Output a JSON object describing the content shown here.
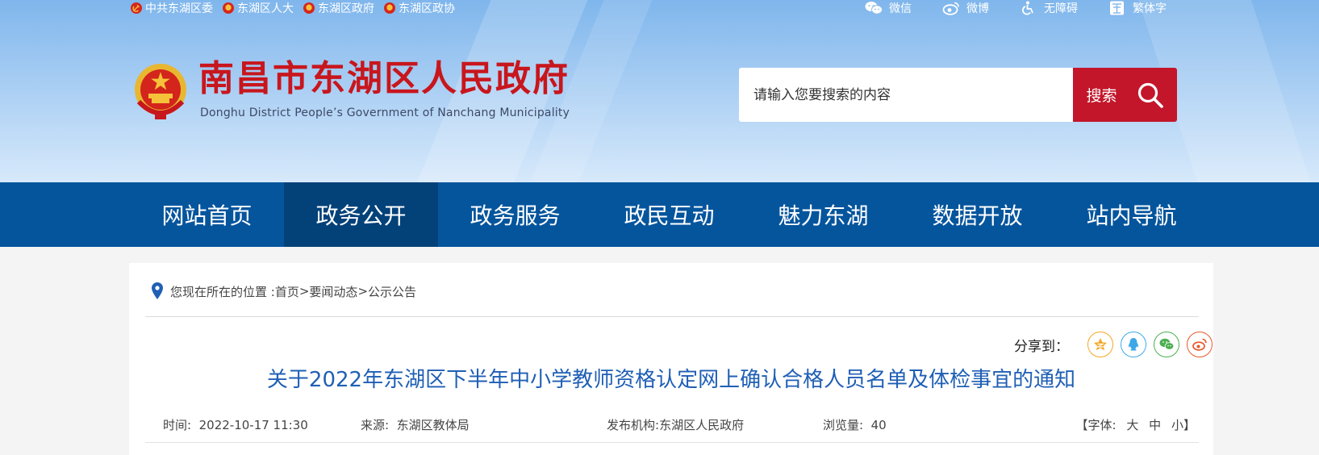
{
  "header": {
    "top_links": [
      {
        "label": "中共东湖区委",
        "icon": "party-emblem-icon"
      },
      {
        "label": "东湖区人大",
        "icon": "national-emblem-icon"
      },
      {
        "label": "东湖区政府",
        "icon": "national-emblem-icon"
      },
      {
        "label": "东湖区政协",
        "icon": "cppcc-emblem-icon"
      }
    ],
    "right_links": [
      {
        "label": "微信",
        "icon": "wechat-icon"
      },
      {
        "label": "微博",
        "icon": "weibo-icon"
      },
      {
        "label": "无障碍",
        "icon": "accessibility-icon"
      },
      {
        "label": "繁体字",
        "icon": "traditional-chinese-icon"
      }
    ],
    "site_title": "南昌市东湖区人民政府",
    "site_subtitle": "Donghu District  People’s Government of Nanchang  Municipality",
    "search": {
      "placeholder": "请输入您要搜索的内容",
      "button_label": "搜索"
    }
  },
  "nav": {
    "items": [
      "网站首页",
      "政务公开",
      "政务服务",
      "政民互动",
      "魅力东湖",
      "数据开放",
      "站内导航"
    ],
    "active_index": 1
  },
  "breadcrumb": {
    "prefix": "您现在所在的位置 : ",
    "items": [
      "首页",
      "要闻动态",
      "公示公告"
    ],
    "separator": ">"
  },
  "share": {
    "label": "分享到：",
    "targets": [
      {
        "name": "qzone",
        "icon": "qzone-icon",
        "color": "#f5a623"
      },
      {
        "name": "qq",
        "icon": "qq-icon",
        "color": "#3ea7e8"
      },
      {
        "name": "wechat",
        "icon": "wechat-icon",
        "color": "#4caf50"
      },
      {
        "name": "weibo",
        "icon": "weibo-icon",
        "color": "#e8572a"
      }
    ]
  },
  "article": {
    "title": "关于2022年东湖区下半年中小学教师资格认定网上确认合格人员名单及体检事宜的通知",
    "meta": {
      "time_label": "时间:",
      "time": "2022-10-17 11:30",
      "source_label": "来源:",
      "source": "东湖区教体局",
      "publisher_label": "发布机构:",
      "publisher": "东湖区人民政府",
      "views_label": "浏览量:",
      "views": "40",
      "font_label": "【字体:",
      "font_large": "大",
      "font_medium": "中",
      "font_small": "小",
      "font_end": "】"
    }
  },
  "colors": {
    "nav_bg": "#05559d",
    "nav_active": "#034179",
    "title_red": "#c8161d",
    "search_btn": "#c3162a",
    "article_title": "#1f5fb5"
  }
}
